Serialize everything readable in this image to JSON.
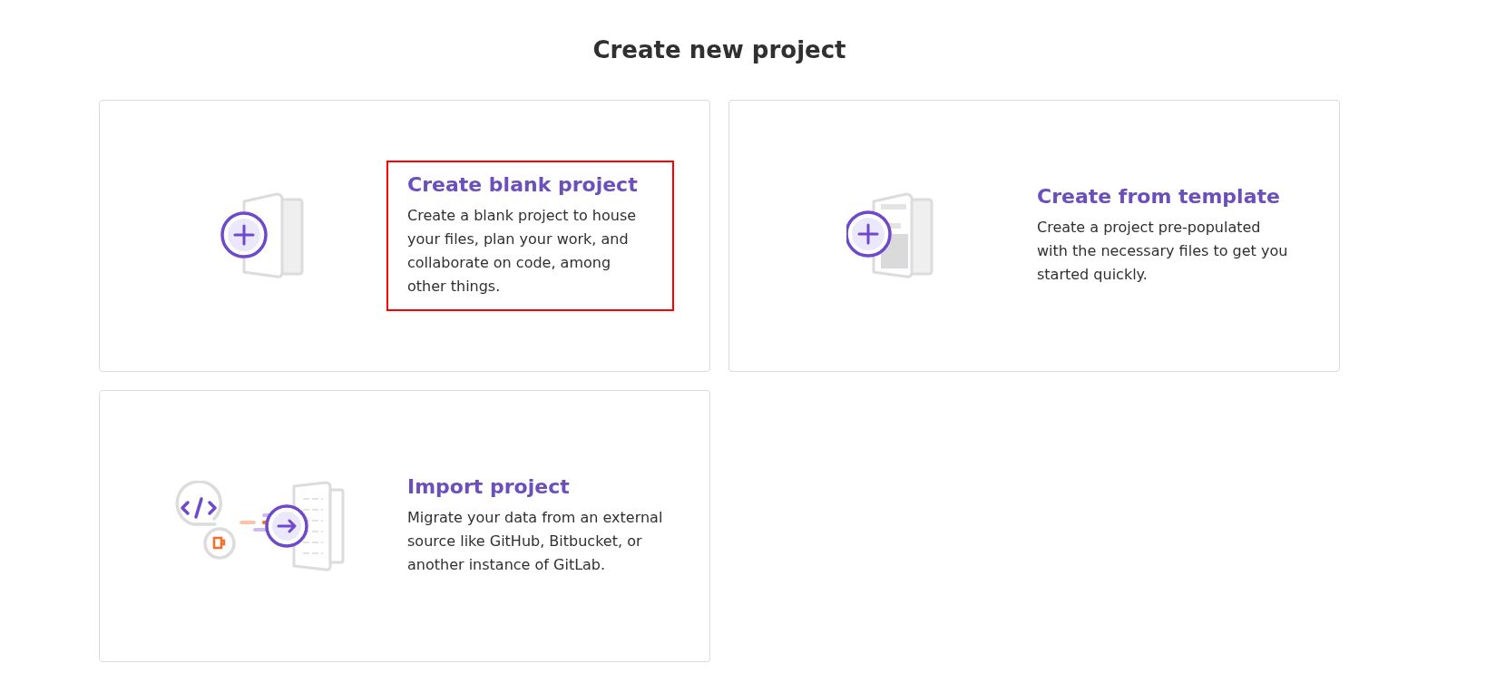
{
  "page": {
    "title": "Create new project"
  },
  "cards": [
    {
      "kind": "blank",
      "title": "Create blank project",
      "description": "Create a blank project to house your files, plan your work, and collaborate on code, among other things.",
      "highlighted": true
    },
    {
      "kind": "template",
      "title": "Create from template",
      "description": "Create a project pre-populated with the necessary files to get you started quickly.",
      "highlighted": false
    },
    {
      "kind": "import",
      "title": "Import project",
      "description": "Migrate your data from an external source like GitHub, Bitbucket, or another instance of GitLab.",
      "highlighted": false
    }
  ]
}
